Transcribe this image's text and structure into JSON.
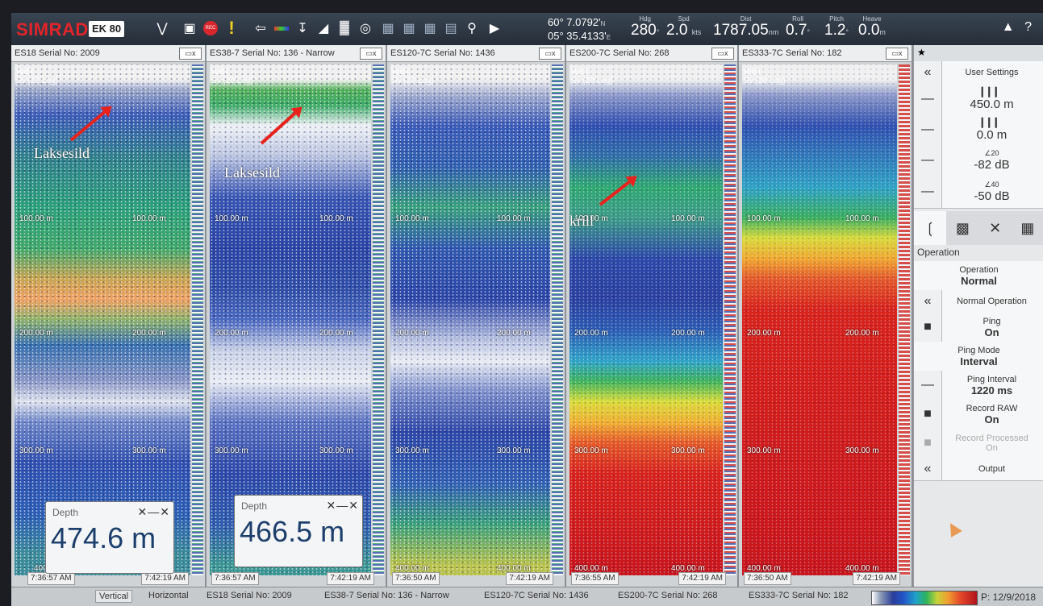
{
  "app": {
    "logo": "SIMRAD",
    "model": "EK 80"
  },
  "toolbar_icons": [
    "chevrons-icon",
    "camera-icon",
    "record-icon",
    "alert-icon",
    "arrow-left-icon",
    "color-bar-icon",
    "depth-icon",
    "bottom-icon",
    "bars-icon",
    "target-icon",
    "grid-icon",
    "grid2-icon",
    "grid3-icon",
    "layers-icon",
    "zoom-icon",
    "export-icon"
  ],
  "rec_label": "REC",
  "nav": {
    "lat": "60° 7.0792'",
    "lat_hem": "N",
    "lon": "05° 35.4133'",
    "lon_hem": "E",
    "hdg_caption": "Hdg",
    "hdg": "280",
    "hdg_unit": "°",
    "spd_caption": "Spd",
    "spd": "2.0",
    "spd_unit": "kts",
    "dist_caption": "Dist",
    "dist": "1787.05",
    "dist_unit": "nm",
    "roll_caption": "Roll",
    "roll": "0.7",
    "roll_unit": "°",
    "pitch_caption": "Pitch",
    "pitch": "1.2",
    "pitch_unit": "°",
    "heave_caption": "Heave",
    "heave": "0.0",
    "heave_unit": "m"
  },
  "top_right": {
    "alert": "▲",
    "help": "?"
  },
  "panes": [
    {
      "title": "ES18 Serial No: 2009",
      "depth_labels": [
        "100.00 m",
        "100.00 m",
        "200.00 m",
        "200.00 m",
        "300.00 m",
        "300.00 m",
        "400",
        "400"
      ],
      "start_time": "7:36:57 AM",
      "end_time": "7:42:19 AM",
      "wbt": "WBT",
      "sv": "Sv (20 Log)",
      "depth_caption": "Depth",
      "depth_value": "474.6 m"
    },
    {
      "title": "ES38-7 Serial No: 136 - Narrow",
      "depth_labels": [
        "100.00 m",
        "100.00 m",
        "200.00 m",
        "200.00 m",
        "300.00 m",
        "300.00 m"
      ],
      "start_time": "7:36:57 AM",
      "end_time": "7:42:19 AM",
      "wbt": "WBT",
      "sv": "Sv (20 Log)",
      "depth_caption": "Depth",
      "depth_value": "466.5 m"
    },
    {
      "title": "ES120-7C Serial No: 1436",
      "depth_labels": [
        "100.00 m",
        "100.00 m",
        "200.00 m",
        "200.00 m",
        "300.00 m",
        "300.00 m",
        "400.00 m",
        "400.00 m"
      ],
      "start_time": "7:36:50 AM",
      "end_time": "7:42:19 AM",
      "wbt": "WBT",
      "sv": "Sv (20 Log)"
    },
    {
      "title": "ES200-7C Serial No: 268",
      "depth_labels": [
        "100.00 m",
        "100.00 m",
        "200.00 m",
        "200.00 m",
        "300.00 m",
        "300.00 m",
        "400.00 m",
        "400.00 m"
      ],
      "start_time": "7:36:55 AM",
      "end_time": "7:42:19 AM",
      "wbt": "WBT",
      "sv": "Sv (20 Log)"
    },
    {
      "title": "ES333-7C Serial No: 182",
      "depth_labels": [
        "100.00 m",
        "100.00 m",
        "200.00 m",
        "200.00 m",
        "300.00 m",
        "300.00 m",
        "400.00 m",
        "400.00 m"
      ],
      "start_time": "7:36:50 AM",
      "end_time": "7:42:19 AM",
      "wbt": "WBT",
      "sv": "Sv (20 Log)"
    }
  ],
  "pane_btn_label": "▭x",
  "annotations": {
    "a1": "Laksesild",
    "a2": "Laksesild",
    "a3": "krill"
  },
  "right_panel": {
    "header": "User Settings",
    "range": "450.0 m",
    "start": "0.0 m",
    "tvg20_exp": "20",
    "tvg20_val": "-82 dB",
    "tvg40_exp": "40",
    "tvg40_val": "-50 dB",
    "section": "Operation",
    "items": [
      {
        "label": "Operation",
        "value": "Normal"
      },
      {
        "label": "Normal Operation",
        "value": ""
      },
      {
        "label": "Ping",
        "value": "On"
      },
      {
        "label": "Ping Mode",
        "value": "Interval"
      },
      {
        "label": "Ping Interval",
        "value": "1220 ms"
      },
      {
        "label": "Record RAW",
        "value": "On"
      },
      {
        "label": "Record Processed",
        "value": "On"
      },
      {
        "label": "Output",
        "value": ""
      }
    ]
  },
  "bottom_tabs": [
    "Vertical",
    "Horizontal",
    "ES18 Serial No: 2009",
    "ES38-7 Serial No: 136 - Narrow",
    "ES120-7C Serial No: 1436",
    "ES200-7C Serial No: 268",
    "ES333-7C Serial No: 182"
  ],
  "date": "P: 12/9/2018",
  "colors": {
    "simrad_red": "#e2242b",
    "arrow_red": "#e8221c",
    "depth_text": "#1c3f6e"
  }
}
